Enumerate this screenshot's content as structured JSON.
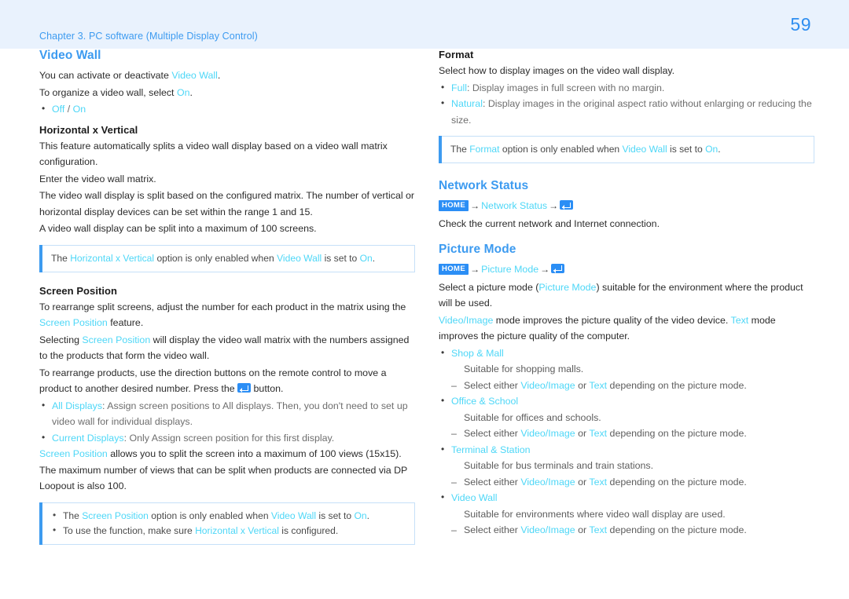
{
  "header": {
    "chapter": "Chapter 3. PC software (Multiple Display Control)",
    "page_number": "59",
    "band_color": "#e9f2fd",
    "chapter_color": "#3d9bf0",
    "page_number_color": "#2e8ef0"
  },
  "colors": {
    "heading_blue": "#3d9bf0",
    "link_cyan": "#4ed7f7",
    "badge_blue": "#2b8ef5",
    "note_border": "#c6e0f8",
    "body_text": "#2b2b2b",
    "muted_text": "#6e6e6e"
  },
  "left_column": {
    "video_wall": {
      "title": "Video Wall",
      "lines": [
        {
          "parts": [
            {
              "t": "You can activate or deactivate ",
              "s": "plain"
            },
            {
              "t": "Video Wall",
              "s": "link"
            },
            {
              "t": ".",
              "s": "plain"
            }
          ]
        },
        {
          "parts": [
            {
              "t": "To organize a video wall, select ",
              "s": "plain"
            },
            {
              "t": "On",
              "s": "link"
            },
            {
              "t": ".",
              "s": "plain"
            }
          ]
        }
      ],
      "options": [
        {
          "parts": [
            {
              "t": "Off",
              "s": "link"
            },
            {
              "t": " / ",
              "s": "plain"
            },
            {
              "t": "On",
              "s": "link"
            }
          ]
        }
      ]
    },
    "horizontal_x_vertical": {
      "title": "Horizontal x Vertical",
      "paragraphs": [
        "This feature automatically splits a video wall display based on a video wall matrix configuration.",
        "Enter the video wall matrix.",
        "The video wall display is split based on the configured matrix. The number of vertical or horizontal display devices can be set within the range 1 and 15.",
        "A video wall display can be split into a maximum of 100 screens."
      ],
      "note": {
        "parts": [
          {
            "t": "The ",
            "s": "plain"
          },
          {
            "t": "Horizontal x Vertical",
            "s": "link"
          },
          {
            "t": " option is only enabled when ",
            "s": "plain"
          },
          {
            "t": "Video Wall",
            "s": "link"
          },
          {
            "t": " is set to ",
            "s": "plain"
          },
          {
            "t": "On",
            "s": "link"
          },
          {
            "t": ".",
            "s": "plain"
          }
        ]
      }
    },
    "screen_position": {
      "title": "Screen Position",
      "para1": {
        "parts": [
          {
            "t": "To rearrange split screens, adjust the number for each product in the matrix using the ",
            "s": "plain"
          },
          {
            "t": "Screen Position",
            "s": "link"
          },
          {
            "t": " feature.",
            "s": "plain"
          }
        ]
      },
      "para2": {
        "parts": [
          {
            "t": "Selecting ",
            "s": "plain"
          },
          {
            "t": "Screen Position",
            "s": "link"
          },
          {
            "t": " will display the video wall matrix with the numbers assigned to the products that form the video wall.",
            "s": "plain"
          }
        ]
      },
      "para3_before": "To rearrange products, use the direction buttons on the remote control to move a product to another desired number. Press the ",
      "para3_after": " button.",
      "para3_icon": "enter-icon",
      "bullets": [
        {
          "parts": [
            {
              "t": "All Displays",
              "s": "link"
            },
            {
              "t": ": Assign screen positions to All displays. Then, you don't need to set up video wall for individual displays.",
              "s": "muted"
            }
          ]
        },
        {
          "parts": [
            {
              "t": "Current Displays",
              "s": "link"
            },
            {
              "t": ": Only Assign screen position for this first display.",
              "s": "muted"
            }
          ]
        }
      ],
      "para4": {
        "parts": [
          {
            "t": "Screen Position",
            "s": "link"
          },
          {
            "t": " allows you to split the screen into a maximum of 100 views (15x15). The maximum number of views that can be split when products are connected via DP Loopout is also 100.",
            "s": "plain"
          }
        ]
      },
      "notes": [
        {
          "parts": [
            {
              "t": "The ",
              "s": "plain"
            },
            {
              "t": "Screen Position",
              "s": "link"
            },
            {
              "t": " option is only enabled when ",
              "s": "plain"
            },
            {
              "t": "Video Wall",
              "s": "link"
            },
            {
              "t": " is set to ",
              "s": "plain"
            },
            {
              "t": "On",
              "s": "link"
            },
            {
              "t": ".",
              "s": "plain"
            }
          ]
        },
        {
          "parts": [
            {
              "t": "To use the function, make sure ",
              "s": "plain"
            },
            {
              "t": "Horizontal x Vertical",
              "s": "link"
            },
            {
              "t": " is configured.",
              "s": "plain"
            }
          ]
        }
      ]
    }
  },
  "right_column": {
    "format": {
      "title": "Format",
      "intro": "Select how to display images on the video wall display.",
      "bullets": [
        {
          "parts": [
            {
              "t": "Full",
              "s": "link"
            },
            {
              "t": ": Display images in full screen with no margin.",
              "s": "muted"
            }
          ]
        },
        {
          "parts": [
            {
              "t": "Natural",
              "s": "link"
            },
            {
              "t": ": Display images in the original aspect ratio without enlarging or reducing the size.",
              "s": "muted"
            }
          ]
        }
      ],
      "note": {
        "parts": [
          {
            "t": "The ",
            "s": "plain"
          },
          {
            "t": "Format",
            "s": "link"
          },
          {
            "t": " option is only enabled when ",
            "s": "plain"
          },
          {
            "t": "Video Wall",
            "s": "link"
          },
          {
            "t": " is set to ",
            "s": "plain"
          },
          {
            "t": "On",
            "s": "link"
          },
          {
            "t": ".",
            "s": "plain"
          }
        ]
      }
    },
    "network_status": {
      "title": "Network Status",
      "breadcrumb": {
        "home_label": "HOME",
        "arrow": "→",
        "path": "Network Status",
        "end_icon": "enter-icon"
      },
      "description": "Check the current network and Internet connection."
    },
    "picture_mode": {
      "title": "Picture Mode",
      "breadcrumb": {
        "home_label": "HOME",
        "arrow": "→",
        "path": "Picture Mode",
        "end_icon": "enter-icon"
      },
      "para1": {
        "parts": [
          {
            "t": "Select a picture mode (",
            "s": "plain"
          },
          {
            "t": "Picture Mode",
            "s": "link"
          },
          {
            "t": ") suitable for the environment where the product will be used.",
            "s": "plain"
          }
        ]
      },
      "para2": {
        "parts": [
          {
            "t": "Video/Image",
            "s": "link"
          },
          {
            "t": " mode improves the picture quality of the video device. ",
            "s": "plain"
          },
          {
            "t": "Text",
            "s": "link"
          },
          {
            "t": " mode improves the picture quality of the computer.",
            "s": "plain"
          }
        ]
      },
      "modes": [
        {
          "name": "Shop & Mall",
          "description": "Suitable for shopping malls.",
          "sub": {
            "parts": [
              {
                "t": "Select either ",
                "s": "plain"
              },
              {
                "t": "Video/Image",
                "s": "link"
              },
              {
                "t": " or ",
                "s": "plain"
              },
              {
                "t": "Text",
                "s": "link"
              },
              {
                "t": " depending on the picture mode.",
                "s": "plain"
              }
            ]
          }
        },
        {
          "name": "Office & School",
          "description": "Suitable for offices and schools.",
          "sub": {
            "parts": [
              {
                "t": "Select either ",
                "s": "plain"
              },
              {
                "t": "Video/Image",
                "s": "link"
              },
              {
                "t": " or ",
                "s": "plain"
              },
              {
                "t": "Text",
                "s": "link"
              },
              {
                "t": " depending on the picture mode.",
                "s": "plain"
              }
            ]
          }
        },
        {
          "name": "Terminal & Station",
          "description": "Suitable for bus terminals and train stations.",
          "sub": {
            "parts": [
              {
                "t": "Select either ",
                "s": "plain"
              },
              {
                "t": "Video/Image",
                "s": "link"
              },
              {
                "t": " or ",
                "s": "plain"
              },
              {
                "t": "Text",
                "s": "link"
              },
              {
                "t": " depending on the picture mode.",
                "s": "plain"
              }
            ]
          }
        },
        {
          "name": "Video Wall",
          "description": "Suitable for environments where video wall display are used.",
          "sub": {
            "parts": [
              {
                "t": "Select either ",
                "s": "plain"
              },
              {
                "t": "Video/Image",
                "s": "link"
              },
              {
                "t": " or ",
                "s": "plain"
              },
              {
                "t": "Text",
                "s": "link"
              },
              {
                "t": " depending on the picture mode.",
                "s": "plain"
              }
            ]
          }
        }
      ]
    }
  }
}
